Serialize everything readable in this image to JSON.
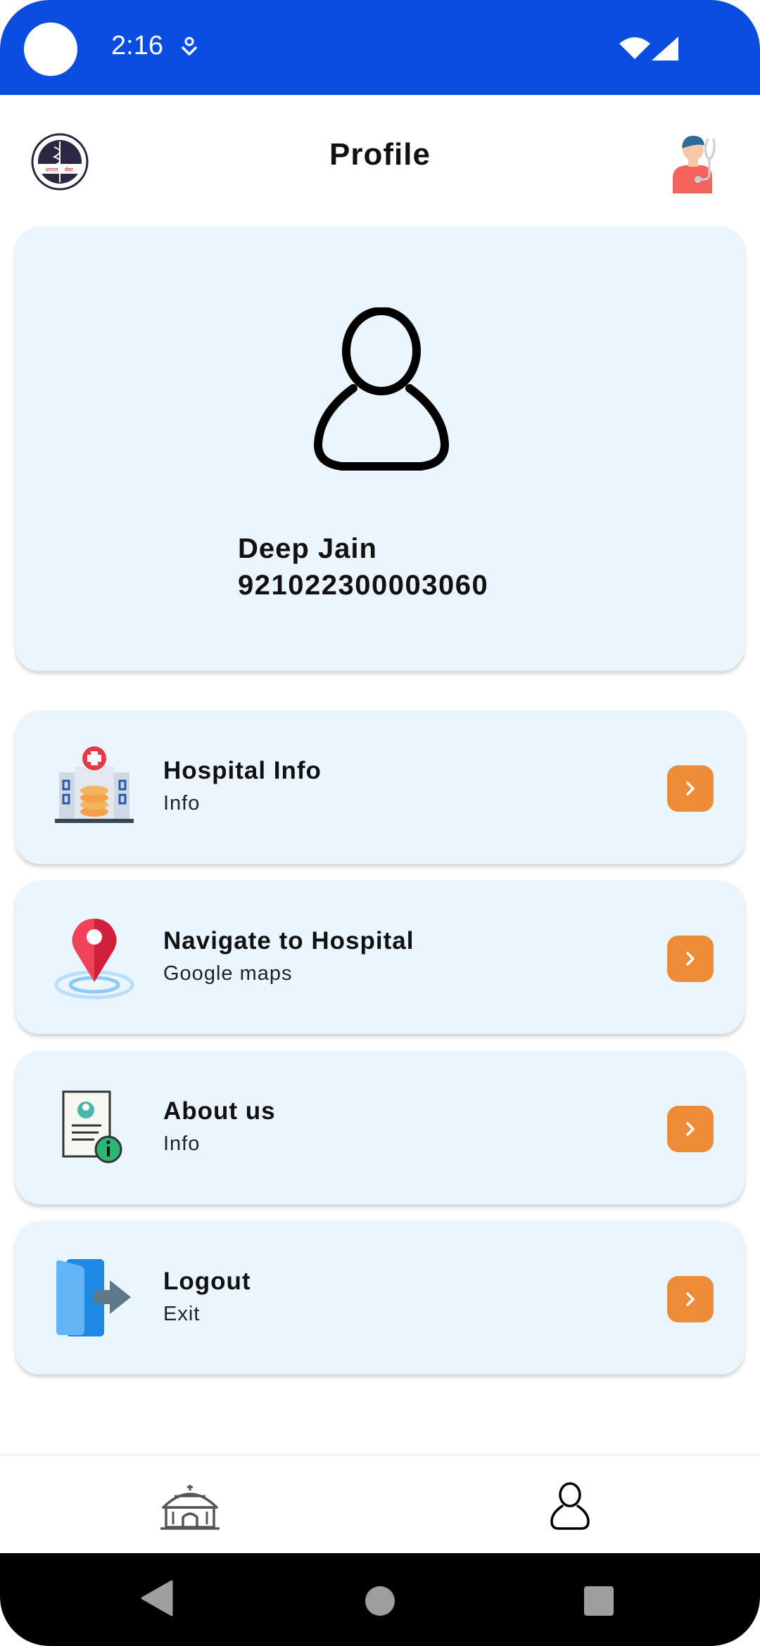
{
  "status_bar": {
    "time": "2:16"
  },
  "header": {
    "title": "Profile"
  },
  "profile": {
    "name": "Deep Jain",
    "id": "921022300003060"
  },
  "menu": [
    {
      "title": "Hospital Info",
      "subtitle": "Info",
      "icon": "hospital-icon"
    },
    {
      "title": "Navigate to Hospital",
      "subtitle": "Google maps",
      "icon": "location-pin-icon"
    },
    {
      "title": "About us",
      "subtitle": "Info",
      "icon": "about-document-icon"
    },
    {
      "title": "Logout",
      "subtitle": "Exit",
      "icon": "logout-door-icon"
    }
  ],
  "bottom_nav": {
    "items": [
      "home-icon",
      "profile-icon"
    ],
    "active": "profile-icon"
  },
  "colors": {
    "status_bar": "#0b4de0",
    "card_background": "#ebf5fe",
    "accent_orange": "#ee8b37"
  }
}
